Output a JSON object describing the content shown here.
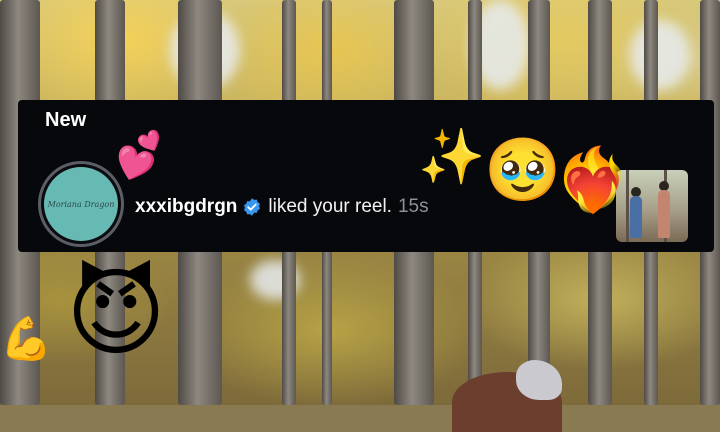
{
  "notification": {
    "section_label": "New",
    "avatar_text": "Moriana Dragon",
    "username": "xxxibgdrgn",
    "action": "liked your reel.",
    "time": "15s",
    "verified_icon": "verified-badge-icon",
    "verified_color": "#3897f0"
  },
  "stickers": {
    "hearts": "💕",
    "sparkles": "✨",
    "pleading": "🥹",
    "heart_fire": "❤️‍🔥",
    "devil": "😈",
    "flex": "💪"
  },
  "colors": {
    "banner_bg": "#07080c",
    "avatar_teal": "#67b9b3",
    "timestamp_gray": "#8e9097"
  }
}
